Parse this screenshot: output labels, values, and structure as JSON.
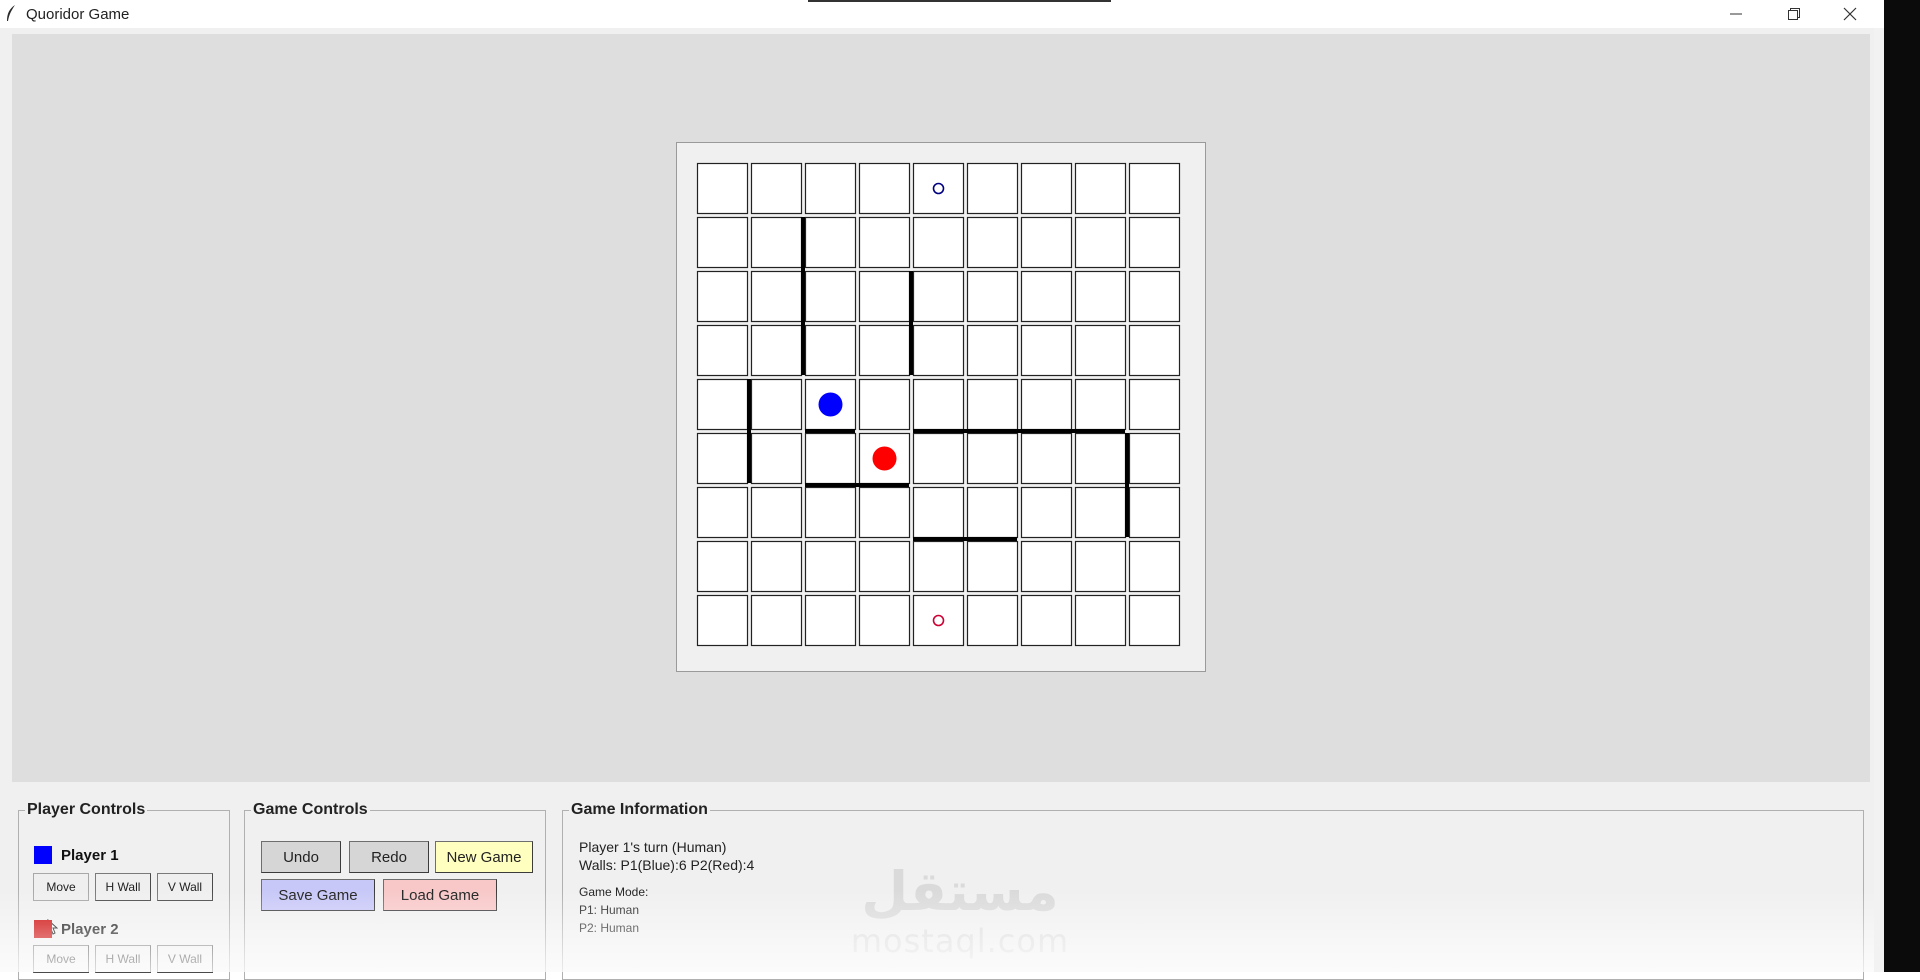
{
  "window": {
    "title": "Quoridor Game",
    "app_icon": "feather-icon",
    "controls": [
      "minimize-icon",
      "maximize-icon",
      "close-icon"
    ]
  },
  "board": {
    "size": 9,
    "cell_color": "#ffffff",
    "players": [
      {
        "name": "Player 1",
        "color": "#0000ff",
        "row": 4,
        "col": 2
      },
      {
        "name": "Player 2",
        "color": "#ff0000",
        "row": 5,
        "col": 3
      }
    ],
    "goal_markers": [
      {
        "color": "#000080",
        "row": 0,
        "col": 4
      },
      {
        "color": "#cc0033",
        "row": 8,
        "col": 4
      }
    ],
    "walls": [
      {
        "orientation": "v",
        "row": 1,
        "col": 2,
        "length": 3
      },
      {
        "orientation": "v",
        "row": 2,
        "col": 4,
        "length": 2
      },
      {
        "orientation": "v",
        "row": 4,
        "col": 1,
        "length": 2
      },
      {
        "orientation": "v",
        "row": 5,
        "col": 8,
        "length": 2
      },
      {
        "orientation": "h",
        "row": 5,
        "col": 2,
        "length": 1
      },
      {
        "orientation": "h",
        "row": 5,
        "col": 4,
        "length": 4
      },
      {
        "orientation": "h",
        "row": 6,
        "col": 2,
        "length": 2
      },
      {
        "orientation": "h",
        "row": 7,
        "col": 4,
        "length": 2
      }
    ]
  },
  "player_controls": {
    "title": "Player Controls",
    "players": [
      {
        "name": "Player 1",
        "color": "#0000ff",
        "move": "Move",
        "hwall": "H Wall",
        "vwall": "V Wall"
      },
      {
        "name": "Player 2",
        "color": "#cc0000",
        "move": "Move",
        "hwall": "H Wall",
        "vwall": "V Wall"
      }
    ]
  },
  "game_controls": {
    "title": "Game Controls",
    "undo": "Undo",
    "redo": "Redo",
    "new_game": "New Game",
    "save_game": "Save Game",
    "load_game": "Load Game"
  },
  "game_info": {
    "title": "Game Information",
    "turn": "Player 1's turn (Human)",
    "walls": "Walls: P1(Blue):6 P2(Red):4",
    "mode_label": "Game Mode:",
    "p1_mode": "P1: Human",
    "p2_mode": "P2: Human"
  },
  "watermark": {
    "logo_text": "مستقل",
    "url": "mostaql.com"
  }
}
